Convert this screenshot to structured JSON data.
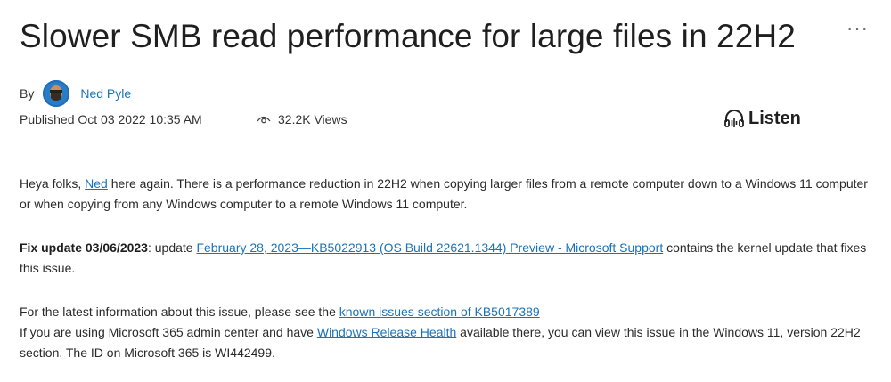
{
  "article": {
    "title": "Slower SMB read performance for large files in 22H2",
    "more_label": "···",
    "byline": {
      "by_label": "By",
      "author": "Ned Pyle"
    },
    "published": "Published Oct 03 2022 10:35 AM",
    "views": "32.2K Views",
    "listen_label": "Listen",
    "paragraphs": {
      "p1": {
        "t1": "Heya folks, ",
        "link": "Ned",
        "t2": " here again. There is a performance reduction in 22H2 when copying larger files from a remote computer down to a Windows 11 computer or when copying from any Windows computer to a remote Windows 11 computer."
      },
      "p2": {
        "bold": "Fix update 03/06/2023",
        "t1": ": update ",
        "link": "February 28, 2023—KB5022913 (OS Build 22621.1344) Preview - Microsoft Support",
        "t2": " contains the kernel update that fixes this issue."
      },
      "p3": {
        "t1": "For the latest information about this issue, please see the ",
        "link": "known issues section of KB5017389"
      },
      "p4": {
        "t1": "If you are using Microsoft 365 admin center and have ",
        "link": "Windows Release Health",
        "t2": " available there, you can view this issue in the Windows 11, version 22H2 section. The ID on Microsoft 365 is WI442499."
      }
    }
  },
  "icons": {
    "views": "eye-icon",
    "listen": "headphones-icon",
    "more": "more-options-icon"
  },
  "colors": {
    "link": "#1a73b9",
    "text": "#2a2a2a",
    "title": "#1f1f1f"
  }
}
